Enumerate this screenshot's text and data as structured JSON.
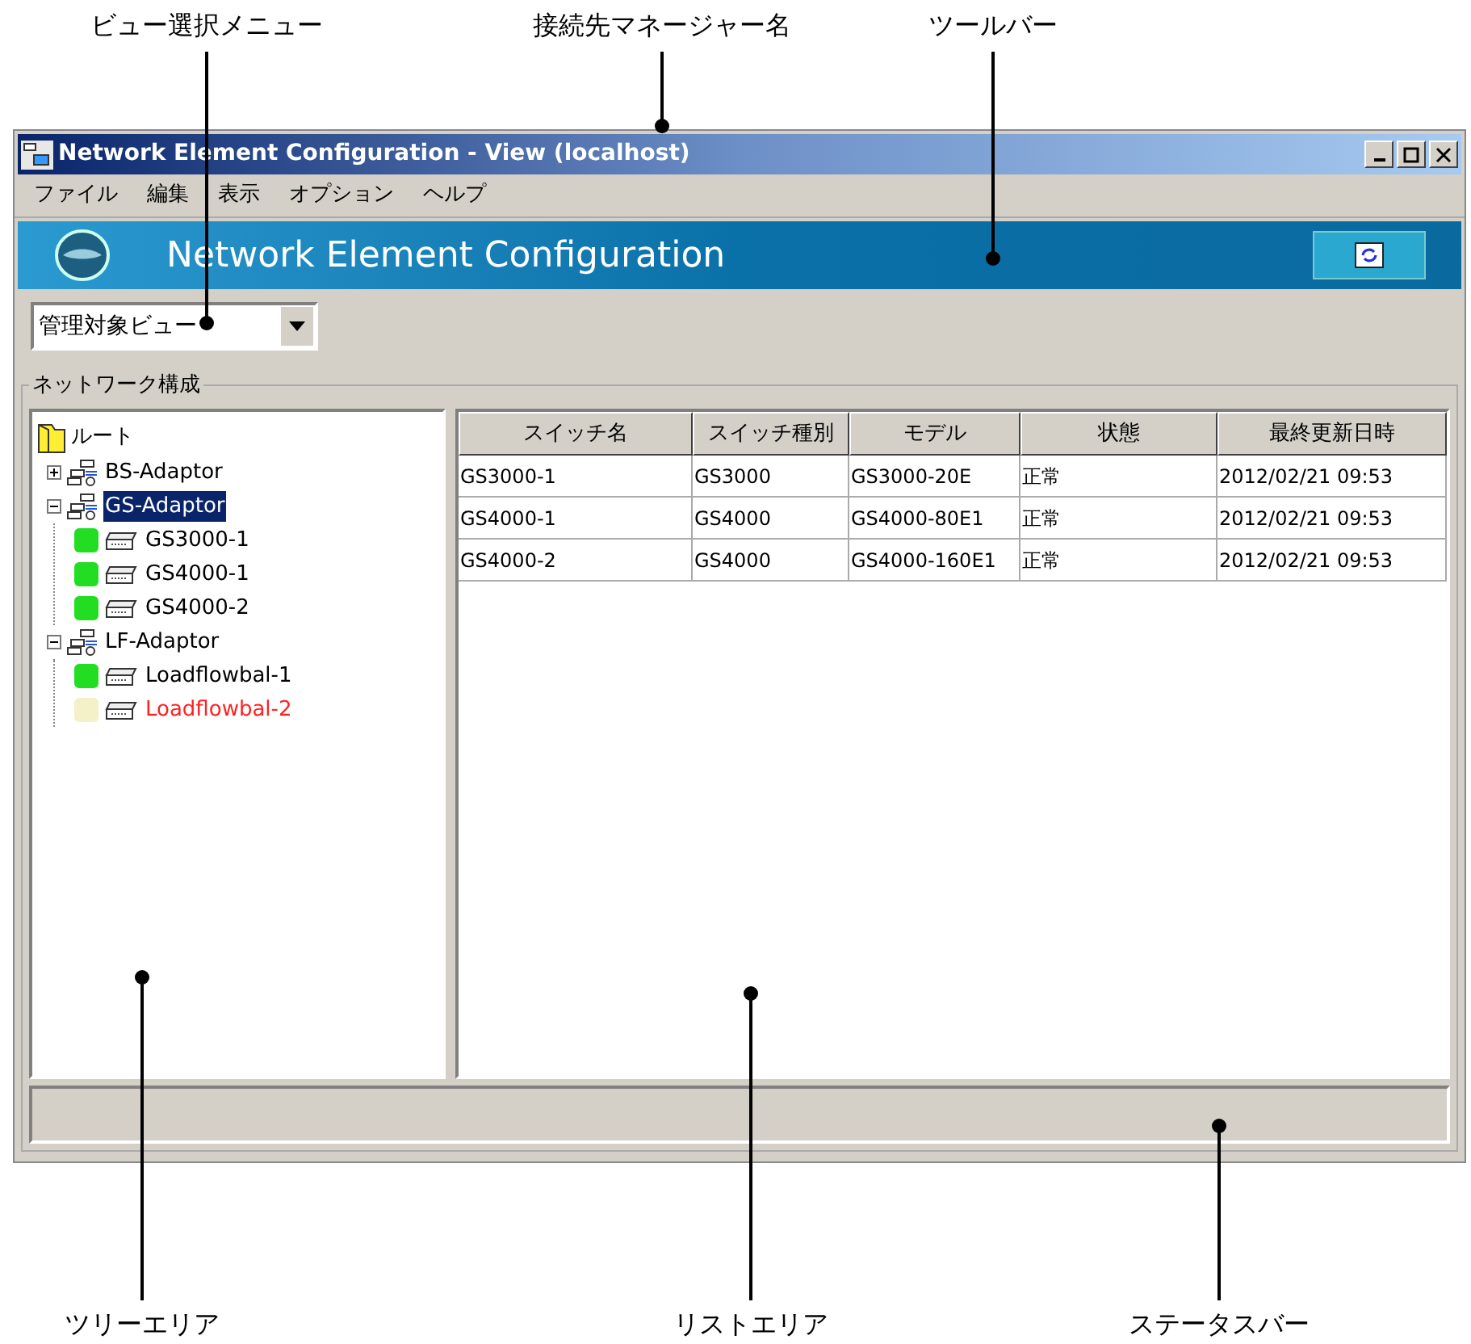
{
  "callouts": [
    {
      "label": "ビュー選択メニュー"
    },
    {
      "label": "接続先マネージャー名"
    },
    {
      "label": "ツールバー"
    },
    {
      "label": "ツリーエリア"
    },
    {
      "label": "リストエリア"
    },
    {
      "label": "ステータスバー"
    }
  ],
  "window": {
    "title": "Network Element Configuration - View (localhost)"
  },
  "menu": [
    "ファイル",
    "編集",
    "表示",
    "オプション",
    "ヘルプ"
  ],
  "banner": {
    "title": "Network Element Configuration"
  },
  "view_selector": {
    "value": "管理対象ビュー"
  },
  "group": {
    "label": "ネットワーク構成"
  },
  "tree": {
    "kind": "root",
    "label": "ルート",
    "children": [
      {
        "kind": "adaptor",
        "label": "BS-Adaptor",
        "expanded": false,
        "selected": false
      },
      {
        "kind": "adaptor",
        "label": "GS-Adaptor",
        "expanded": true,
        "selected": true,
        "children": [
          {
            "kind": "switch",
            "label": "GS3000-1",
            "color": "#22dd22",
            "error": false,
            "selected": false
          },
          {
            "kind": "switch",
            "label": "GS4000-1",
            "color": "#22dd22",
            "error": false,
            "selected": false
          },
          {
            "kind": "switch",
            "label": "GS4000-2",
            "color": "#22dd22",
            "error": false,
            "selected": false
          }
        ]
      },
      {
        "kind": "adaptor",
        "label": "LF-Adaptor",
        "expanded": true,
        "selected": false,
        "children": [
          {
            "kind": "switch",
            "label": "Loadflowbal-1",
            "color": "#22dd22",
            "error": false,
            "selected": false
          },
          {
            "kind": "switch",
            "label": "Loadflowbal-2",
            "color": "#f4f0c8",
            "error": true,
            "selected": false
          }
        ]
      }
    ]
  },
  "table": {
    "columns": [
      "スイッチ名",
      "スイッチ種別",
      "モデル",
      "状態",
      "最終更新日時"
    ],
    "rows": [
      [
        "GS3000-1",
        "GS3000",
        "GS3000-20E",
        "正常",
        "2012/02/21 09:53"
      ],
      [
        "GS4000-1",
        "GS4000",
        "GS4000-80E1",
        "正常",
        "2012/02/21 09:53"
      ],
      [
        "GS4000-2",
        "GS4000",
        "GS4000-160E1",
        "正常",
        "2012/02/21 09:53"
      ]
    ]
  }
}
